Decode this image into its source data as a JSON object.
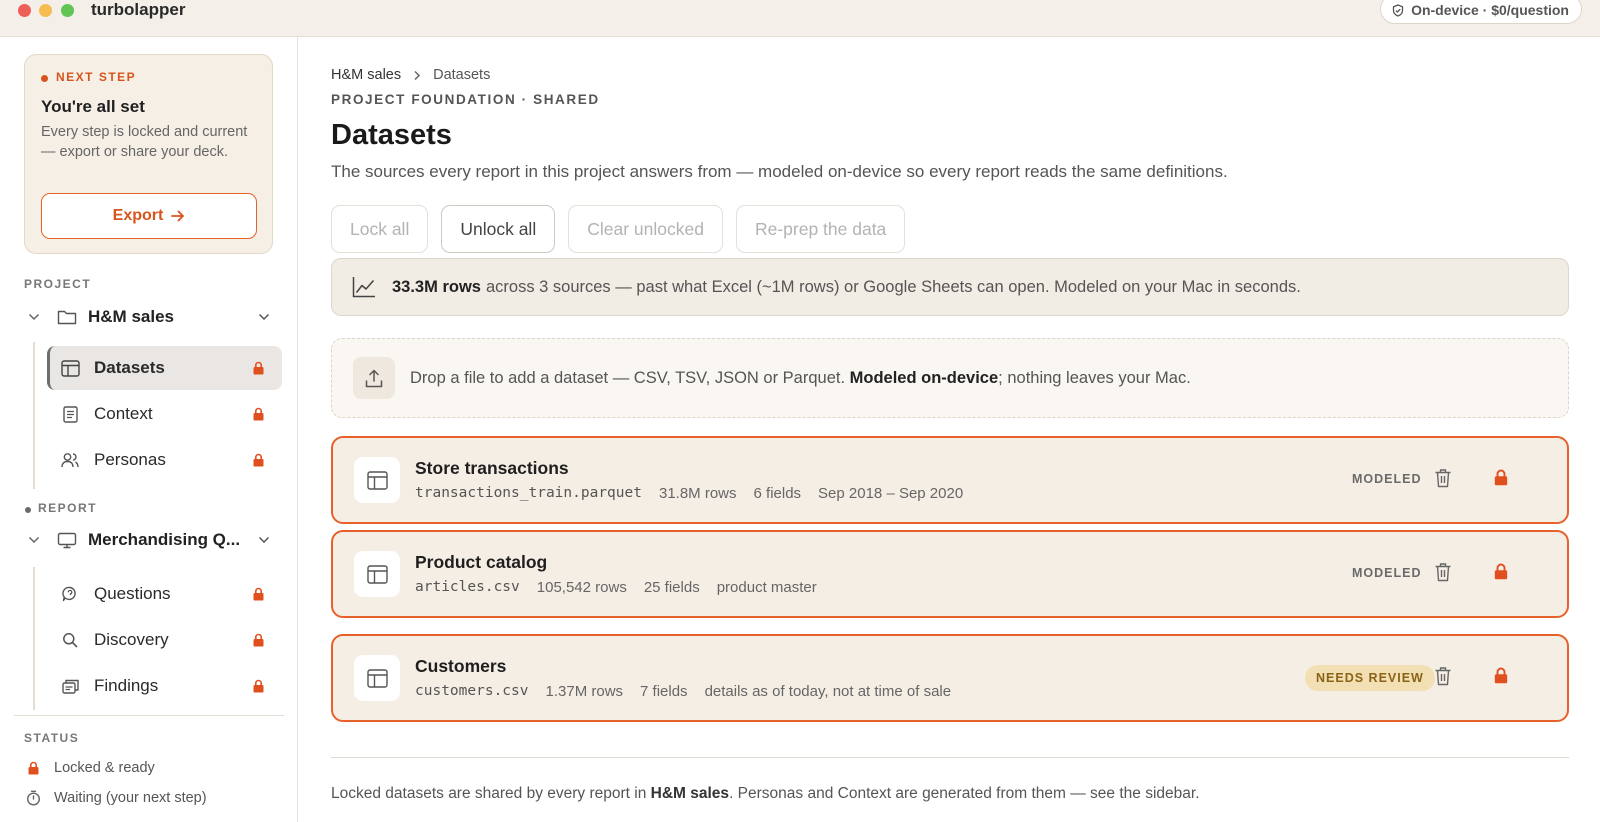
{
  "app": {
    "title": "turbolapper",
    "badge": "On-device · $0/question"
  },
  "sidebar": {
    "next_step": {
      "label": "NEXT STEP",
      "title": "You're all set",
      "body": "Every step is locked and current — export or share your deck.",
      "export_label": "Export"
    },
    "project_label": "PROJECT",
    "project": {
      "name": "H&M sales",
      "items": [
        {
          "label": "Datasets",
          "icon": "table-icon",
          "active": true
        },
        {
          "label": "Context",
          "icon": "document-icon"
        },
        {
          "label": "Personas",
          "icon": "users-icon"
        }
      ]
    },
    "report_label": "REPORT",
    "report": {
      "name": "Merchandising Q...",
      "items": [
        {
          "label": "Questions",
          "icon": "chat-icon"
        },
        {
          "label": "Discovery",
          "icon": "search-icon"
        },
        {
          "label": "Findings",
          "icon": "slides-icon"
        }
      ]
    },
    "status": {
      "label": "STATUS",
      "items": [
        {
          "label": "Locked & ready",
          "icon": "lock-icon"
        },
        {
          "label": "Waiting (your next step)",
          "icon": "timer-icon"
        }
      ]
    }
  },
  "main": {
    "breadcrumb": [
      "H&M sales",
      "Datasets"
    ],
    "eyebrow": "PROJECT FOUNDATION · SHARED",
    "title": "Datasets",
    "subtitle": "The sources every report in this project answers from — modeled on-device so every report reads the same definitions.",
    "actions": [
      {
        "label": "Lock all",
        "enabled": false
      },
      {
        "label": "Unlock all",
        "enabled": true
      },
      {
        "label": "Clear unlocked",
        "enabled": false
      },
      {
        "label": "Re-prep the data",
        "enabled": false
      }
    ],
    "banner": {
      "bold": "33.3M rows",
      "text": "across 3 sources — past what Excel (~1M rows) or Google Sheets can open. Modeled on your Mac in seconds."
    },
    "drop": {
      "pre": "Drop a file to add a dataset — CSV, TSV, JSON or Parquet.",
      "bold": "Modeled on-device",
      "post": "; nothing leaves your Mac."
    },
    "datasets": [
      {
        "name": "Store transactions",
        "file": "transactions_train.parquet",
        "rows": "31.8M rows",
        "fields": "6 fields",
        "note": "Sep 2018 – Sep 2020",
        "status": "MODELED"
      },
      {
        "name": "Product catalog",
        "file": "articles.csv",
        "rows": "105,542 rows",
        "fields": "25 fields",
        "note": "product master",
        "status": "MODELED"
      },
      {
        "name": "Customers",
        "file": "customers.csv",
        "rows": "1.37M rows",
        "fields": "7 fields",
        "note": "details as of today, not at time of sale",
        "status": "NEEDS REVIEW"
      }
    ],
    "footnote": {
      "pre": "Locked datasets are shared by every report in",
      "bold": "H&M sales",
      "post": ". Personas and Context are generated from them — see the sidebar."
    }
  },
  "colors": {
    "accent": "#e8602a",
    "lock": "#e0501f",
    "review_bg": "#f2dfb4",
    "review_fg": "#8a6416"
  }
}
